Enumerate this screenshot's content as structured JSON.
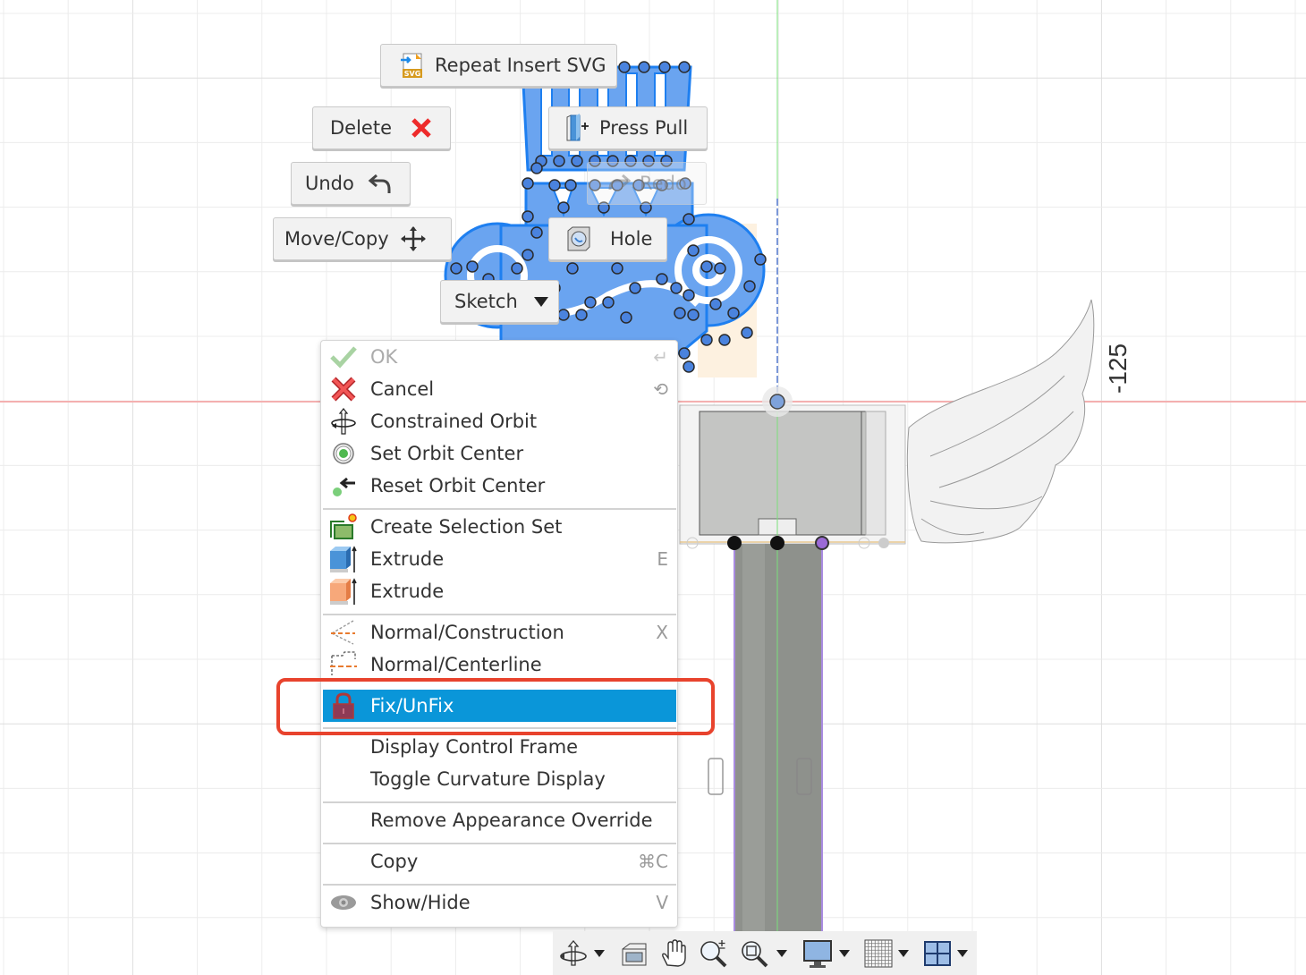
{
  "app": "Fusion 360 design canvas",
  "marking_menu": {
    "repeat_insert_svg": {
      "label": "Repeat Insert SVG",
      "icon": "insert-svg-icon"
    },
    "delete": {
      "label": "Delete",
      "icon": "red-x-icon"
    },
    "undo": {
      "label": "Undo",
      "icon": "undo-arrow-icon"
    },
    "move_copy": {
      "label": "Move/Copy",
      "icon": "move-arrows-icon"
    },
    "press_pull": {
      "label": "Press Pull",
      "icon": "press-pull-icon"
    },
    "redo": {
      "label": "Redo",
      "icon": "redo-arrow-icon",
      "state": "disabled"
    },
    "hole": {
      "label": "Hole",
      "icon": "hole-icon"
    },
    "sketch": {
      "label": "Sketch",
      "icon": "dropdown-caret-icon"
    }
  },
  "context_menu": {
    "groups": [
      [
        {
          "label": "OK",
          "shortcut": "↵",
          "icon": "check-icon",
          "disabled": true
        },
        {
          "label": "Cancel",
          "shortcut": "⟲",
          "icon": "cancel-x-icon"
        },
        {
          "label": "Constrained Orbit",
          "shortcut": "",
          "icon": "constrained-orbit-icon"
        },
        {
          "label": "Set Orbit Center",
          "shortcut": "",
          "icon": "set-orbit-center-icon"
        },
        {
          "label": "Reset Orbit Center",
          "shortcut": "",
          "icon": "reset-orbit-center-icon"
        }
      ],
      [
        {
          "label": "Create Selection Set",
          "shortcut": "",
          "icon": "selection-set-icon"
        },
        {
          "label": "Extrude",
          "shortcut": "E",
          "icon": "extrude-blue-icon"
        },
        {
          "label": "Extrude",
          "shortcut": "",
          "icon": "extrude-orange-icon"
        }
      ],
      [
        {
          "label": "Normal/Construction",
          "shortcut": "X",
          "icon": "normal-construction-icon"
        },
        {
          "label": "Normal/Centerline",
          "shortcut": "",
          "icon": "normal-centerline-icon"
        }
      ],
      [
        {
          "label": "Fix/UnFix",
          "shortcut": "",
          "icon": "lock-icon",
          "highlighted": true
        }
      ],
      [
        {
          "label": "Display Control Frame",
          "shortcut": "",
          "icon": ""
        },
        {
          "label": "Toggle Curvature Display",
          "shortcut": "",
          "icon": ""
        }
      ],
      [
        {
          "label": "Remove Appearance Override",
          "shortcut": "",
          "icon": ""
        }
      ],
      [
        {
          "label": "Copy",
          "shortcut": "⌘C",
          "icon": ""
        }
      ],
      [
        {
          "label": "Show/Hide",
          "shortcut": "V",
          "icon": "eye-icon"
        }
      ]
    ]
  },
  "canvas": {
    "dimension_label": "-125",
    "axis_colors": {
      "x_axis": "#f4a9a9",
      "y_axis": "#5fd35f",
      "selection_blue": "#1e7ff0",
      "fill_blue": "#6aa4f0"
    }
  },
  "annotation": {
    "color": "#e8432d",
    "target": "Fix/UnFix"
  },
  "nav_toolbar": {
    "buttons": [
      {
        "name": "orbit",
        "icon": "orbit-icon",
        "has_dropdown": true
      },
      {
        "name": "look-at",
        "icon": "look-at-icon",
        "has_dropdown": false
      },
      {
        "name": "pan",
        "icon": "pan-hand-icon",
        "has_dropdown": false
      },
      {
        "name": "zoom",
        "icon": "zoom-icon",
        "has_dropdown": false
      },
      {
        "name": "fit",
        "icon": "zoom-window-icon",
        "has_dropdown": true
      },
      {
        "name": "display-settings",
        "icon": "monitor-icon",
        "has_dropdown": true
      },
      {
        "name": "grid-snaps",
        "icon": "grid-icon",
        "has_dropdown": true
      },
      {
        "name": "viewports",
        "icon": "viewports-icon",
        "has_dropdown": true
      }
    ]
  }
}
